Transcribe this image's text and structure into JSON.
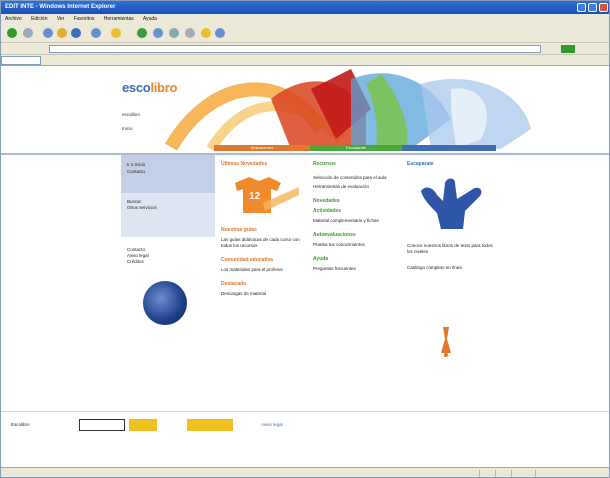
{
  "window": {
    "title": "EDIT INTE - Windows Internet Explorer"
  },
  "menubar": [
    "Archivo",
    "Edición",
    "Ver",
    "Favoritos",
    "Herramientas",
    "Ayuda"
  ],
  "site": {
    "logo_main": "escolibro",
    "logo_accent": "libro",
    "banner_note_1": "escolibro",
    "banner_note_2": "Inicio"
  },
  "nav": {
    "seg1": "Aplicaciones",
    "seg2": "Escaparate"
  },
  "sidebar": {
    "box1_line1": "Ir a Inicio",
    "box1_line2": "Contacto",
    "box2_line1": "Buscar",
    "box2_line2": "Otros servicios",
    "info_line1": "Contacto",
    "info_line2": "Aviso legal",
    "info_line3": "Créditos"
  },
  "col1": {
    "head": "Ultimas Novedades",
    "shirt_number": "12",
    "section1": "Nuestras guías",
    "p1": "Las guías didácticas de cada curso con todos los recursos",
    "section2": "Comunidad educativa",
    "p2": "Los materiales para el profesor",
    "section3": "Destacado",
    "p3": "Descargas de material"
  },
  "col2": {
    "head": "Recursos",
    "p1": "Selección de contenidos para el aula",
    "p2": "Herramientas de evaluación",
    "link1": "Novedades",
    "link2": "Actividades",
    "p3": "Material complementario y fichas",
    "link3": "Autoevaluaciones",
    "p4": "Prueba tus conocimientos",
    "link4": "Ayuda",
    "p5": "Preguntas frecuentes"
  },
  "col3": {
    "head": "Escaparate",
    "p1": "Conoce nuestros libros de texto para todos los niveles",
    "p2": "Catálogo completo en línea"
  },
  "footer": {
    "text": "Escolibro",
    "link": "Aviso legal"
  },
  "colors": {
    "nav_orange": "#e0772a",
    "nav_green": "#4aa83a",
    "nav_blue": "#3d6db5"
  }
}
